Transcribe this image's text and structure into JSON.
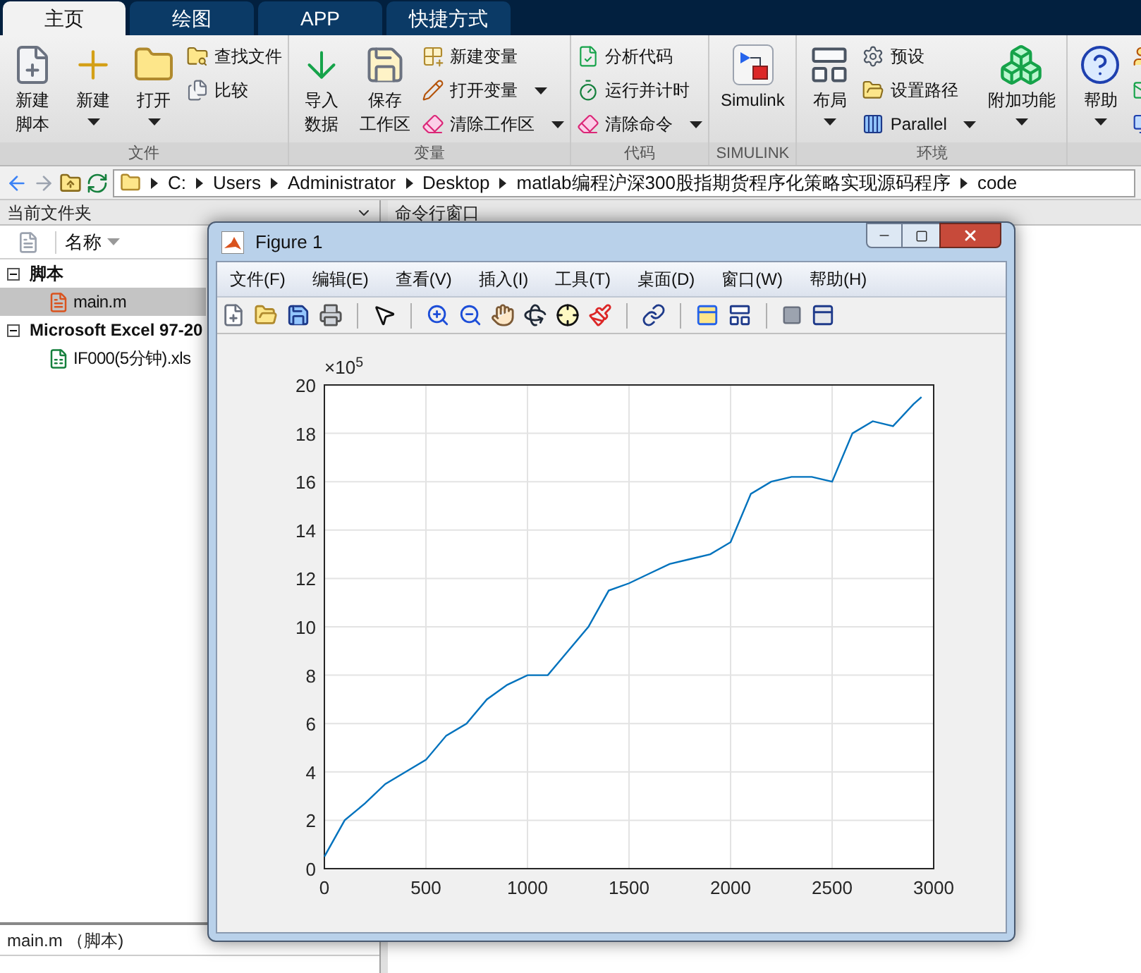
{
  "tabs": [
    {
      "label": "主页",
      "selected": true
    },
    {
      "label": "绘图",
      "selected": false
    },
    {
      "label": "APP",
      "selected": false
    },
    {
      "label": "快捷方式",
      "selected": false
    }
  ],
  "ribbon": {
    "groups": [
      {
        "label": "文件",
        "columns": [
          {
            "kind": "large",
            "lines": [
              "新建",
              "脚本"
            ],
            "dropdown": false
          },
          {
            "kind": "large",
            "lines": [
              "新建"
            ],
            "dropdown": true
          },
          {
            "kind": "large",
            "lines": [
              "打开"
            ],
            "dropdown": true
          },
          {
            "kind": "stack",
            "items": [
              {
                "label": "查找文件",
                "dropdown": false
              },
              {
                "label": "比较",
                "dropdown": false
              }
            ]
          }
        ]
      },
      {
        "label": "变量",
        "columns": [
          {
            "kind": "large",
            "lines": [
              "导入",
              "数据"
            ],
            "dropdown": false
          },
          {
            "kind": "large",
            "lines": [
              "保存",
              "工作区"
            ],
            "dropdown": false
          },
          {
            "kind": "stack",
            "items": [
              {
                "label": "新建变量",
                "dropdown": false
              },
              {
                "label": "打开变量",
                "dropdown": true
              },
              {
                "label": "清除工作区",
                "dropdown": true
              }
            ]
          }
        ]
      },
      {
        "label": "代码",
        "columns": [
          {
            "kind": "stack",
            "items": [
              {
                "label": "分析代码",
                "dropdown": false
              },
              {
                "label": "运行并计时",
                "dropdown": false
              },
              {
                "label": "清除命令",
                "dropdown": true
              }
            ]
          }
        ]
      },
      {
        "label": "SIMULINK",
        "columns": [
          {
            "kind": "large",
            "lines": [
              "Simulink"
            ],
            "dropdown": false
          }
        ]
      },
      {
        "label": "环境",
        "columns": [
          {
            "kind": "large",
            "lines": [
              "布局"
            ],
            "dropdown": true
          },
          {
            "kind": "stack",
            "items": [
              {
                "label": "预设",
                "dropdown": false
              },
              {
                "label": "设置路径",
                "dropdown": false
              },
              {
                "label": "Parallel",
                "dropdown": true
              }
            ]
          },
          {
            "kind": "large",
            "lines": [
              "附加功能"
            ],
            "dropdown": true
          }
        ]
      },
      {
        "columns": [
          {
            "kind": "large",
            "lines": [
              "帮助"
            ],
            "dropdown": true
          },
          {
            "kind": "stack",
            "items": [
              {
                "dropdown": false
              },
              {
                "dropdown": false
              },
              {
                "dropdown": false
              }
            ]
          }
        ]
      }
    ]
  },
  "address_bar": {
    "path": [
      "C:",
      "Users",
      "Administrator",
      "Desktop",
      "matlab编程沪深300股指期货程序化策略实现源码程序",
      "code"
    ]
  },
  "current_folder": {
    "title": "当前文件夹",
    "column": "名称",
    "tree": [
      {
        "label": "脚本",
        "expanded": true,
        "children": [
          {
            "label": "main.m",
            "selected": true
          }
        ]
      },
      {
        "label": "Microsoft Excel 97-20",
        "expanded": true,
        "children": [
          {
            "label": "IF000(5分钟).xls",
            "selected": false
          }
        ]
      }
    ],
    "details": "main.m （脚本)"
  },
  "command_window": {
    "title": "命令行窗口"
  },
  "figure": {
    "title": "Figure 1",
    "menu": [
      "文件(F)",
      "编辑(E)",
      "查看(V)",
      "插入(I)",
      "工具(T)",
      "桌面(D)",
      "窗口(W)",
      "帮助(H)"
    ],
    "exponent": "×10$^{5}$",
    "chart_data": {
      "type": "line",
      "x": [
        0,
        100,
        200,
        300,
        400,
        500,
        600,
        700,
        800,
        900,
        1000,
        1100,
        1200,
        1300,
        1400,
        1500,
        1600,
        1700,
        1800,
        1900,
        2000,
        2100,
        2200,
        2300,
        2400,
        2500,
        2600,
        2700,
        2800,
        2900,
        2940
      ],
      "grid": true,
      "series": [
        {
          "color": "#0072bd",
          "values": [
            0.5,
            2.0,
            2.7,
            3.5,
            4.0,
            4.5,
            5.5,
            6.0,
            7.0,
            7.6,
            8.0,
            8.0,
            9.0,
            10.0,
            11.5,
            11.8,
            12.2,
            12.6,
            12.8,
            13.0,
            13.5,
            15.5,
            16.0,
            16.2,
            16.2,
            16.0,
            18.0,
            18.5,
            18.3,
            19.2,
            19.5
          ]
        }
      ],
      "xlim": [
        0,
        3000
      ],
      "ylim": [
        0,
        20
      ],
      "xticks": [
        0,
        500,
        1000,
        1500,
        2000,
        2500,
        3000
      ],
      "yticks": [
        0,
        2,
        4,
        6,
        8,
        10,
        12,
        14,
        16,
        18,
        20
      ]
    }
  }
}
